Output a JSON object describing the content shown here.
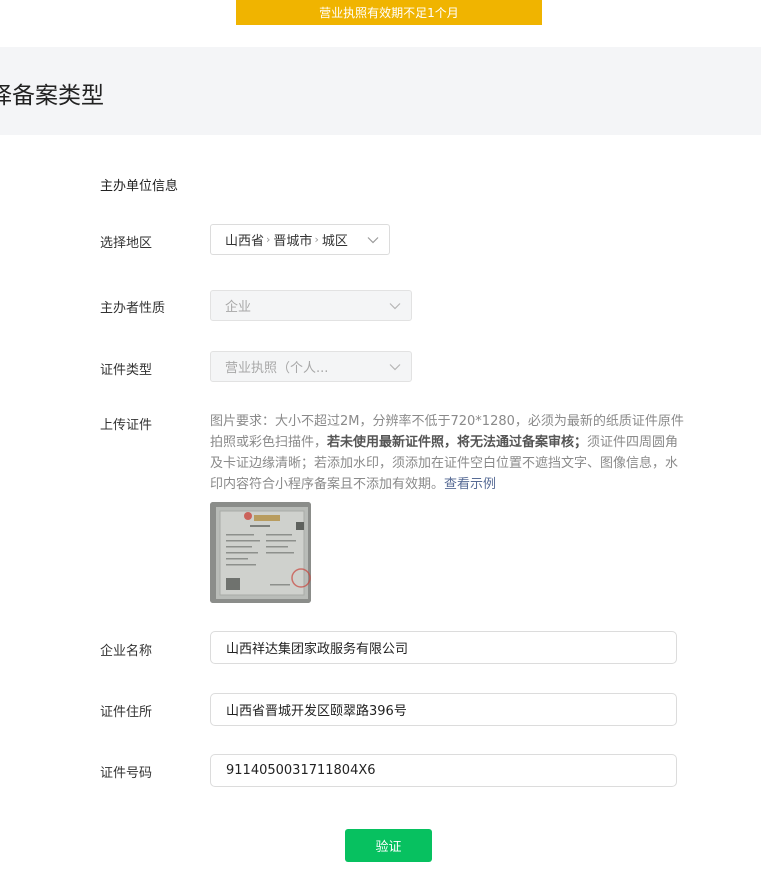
{
  "warning_banner": "营业执照有效期不足1个月",
  "page_title": "择备案类型",
  "section_title": "主办单位信息",
  "region": {
    "label": "选择地区",
    "province": "山西省",
    "city": "晋城市",
    "district": "城区"
  },
  "organizer_type": {
    "label": "主办者性质",
    "value": "企业"
  },
  "certificate_type": {
    "label": "证件类型",
    "value": "营业执照（个人..."
  },
  "upload": {
    "label": "上传证件",
    "desc_part1": "图片要求：大小不超过2M，分辨率不低于720*1280，必须为最新的纸质证件原件拍照或彩色扫描件，",
    "desc_bold": "若未使用最新证件照，将无法通过备案审核；",
    "desc_part2": "须证件四周圆角及卡证边缘清晰；若添加水印，须添加在证件空白位置不遮挡文字、图像信息，水印内容符合小程序备案且不添加有效期。",
    "example_link": "查看示例"
  },
  "company_name": {
    "label": "企业名称",
    "value": "山西祥达集团家政服务有限公司"
  },
  "company_address": {
    "label": "证件住所",
    "value": "山西省晋城开发区颐翠路396号"
  },
  "certificate_number": {
    "label": "证件号码",
    "value": "9114050031711804X6"
  },
  "verify_button": "验证",
  "colors": {
    "warning": "#f0b400",
    "primary": "#07c160",
    "link": "#576b95",
    "title_band": "#f4f5f7"
  }
}
